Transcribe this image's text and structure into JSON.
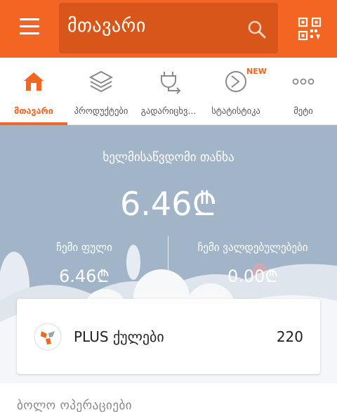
{
  "header": {
    "title": "მთავარი",
    "search_icon": "search-icon",
    "qr_icon": "qr-scan-icon",
    "menu_icon": "hamburger-icon"
  },
  "nav": {
    "items": [
      {
        "label": "მთავარი",
        "icon": "home-icon",
        "active": true
      },
      {
        "label": "პროდუქტები",
        "icon": "layers-icon",
        "active": false
      },
      {
        "label": "გადარიცხვ...",
        "icon": "transfer-icon",
        "active": false
      },
      {
        "label": "სტატისტიკა",
        "icon": "statistics-icon",
        "active": false,
        "badge": "NEW"
      },
      {
        "label": "მეტი",
        "icon": "more-dots-icon",
        "active": false
      }
    ]
  },
  "balance": {
    "available_label": "ხელმისაწვდომი თანხა",
    "available_amount": "6.46₾",
    "my_money_label": "ჩემი ფული",
    "my_money_amount": "6.46₾",
    "obligations_label": "ჩემი ვალდებულებები",
    "obligations_amount": "0.00₾"
  },
  "plus": {
    "label": "PLUS ქულები",
    "count": "220"
  },
  "recent": {
    "title": "ბოლო ოპერაციები"
  },
  "colors": {
    "accent": "#f26522",
    "panel": "#a2b5c8"
  }
}
